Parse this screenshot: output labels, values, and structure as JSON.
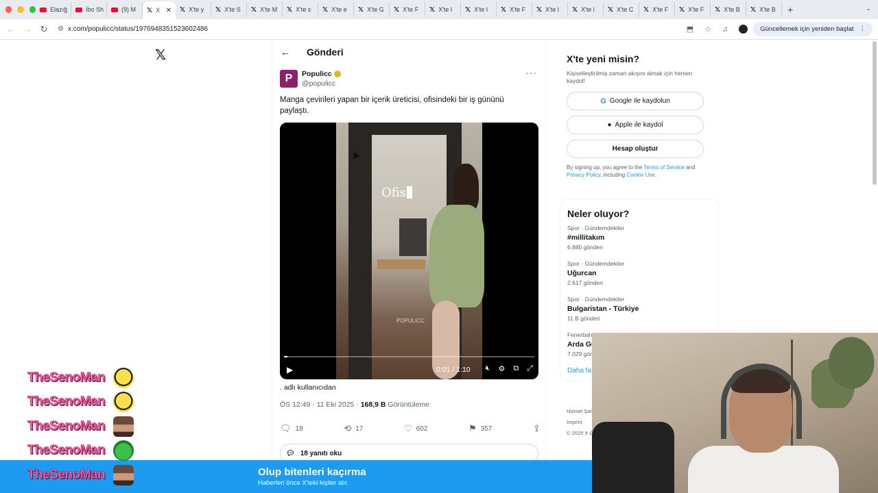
{
  "colors": {
    "x_blue": "#1d9bf0",
    "chat_name": "#ff5aa5",
    "populicc_brand": "#8e1f6d"
  },
  "browser": {
    "traffic_lights": [
      "#ff5f57",
      "#febc2e",
      "#28c840"
    ],
    "tabs": [
      {
        "icon": "youtube-icon",
        "label": "Elazığ"
      },
      {
        "icon": "youtube-icon",
        "label": "İbo Sh"
      },
      {
        "icon": "youtube-icon",
        "label": "(9) M"
      },
      {
        "icon": "x-icon",
        "label": "X",
        "active": true
      },
      {
        "icon": "x-icon",
        "label": "X'te y"
      },
      {
        "icon": "x-icon",
        "label": "X'te S"
      },
      {
        "icon": "x-icon",
        "label": "X'te M"
      },
      {
        "icon": "x-icon",
        "label": "X'te s"
      },
      {
        "icon": "x-icon",
        "label": "X'te e"
      },
      {
        "icon": "x-icon",
        "label": "X'te G"
      },
      {
        "icon": "x-icon",
        "label": "X'te F"
      },
      {
        "icon": "x-icon",
        "label": "X'te I"
      },
      {
        "icon": "x-icon",
        "label": "X'te I"
      },
      {
        "icon": "x-icon",
        "label": "X'te F"
      },
      {
        "icon": "x-icon",
        "label": "X'te l"
      },
      {
        "icon": "x-icon",
        "label": "X'te l"
      },
      {
        "icon": "x-icon",
        "label": "X'te C"
      },
      {
        "icon": "x-icon",
        "label": "X'te F"
      },
      {
        "icon": "x-icon",
        "label": "X'te F"
      },
      {
        "icon": "x-icon",
        "label": "X'te B"
      },
      {
        "icon": "x-icon",
        "label": "X'te B"
      }
    ],
    "url": "x.com/populicc/status/1976948351523602486",
    "update_button": "Güncellemek için yeniden başlat"
  },
  "post": {
    "header_title": "Gönderi",
    "author_initial": "P",
    "author_name": "Populicc",
    "author_handle": "@populicc",
    "text": "Manga çevirileri yapan bir içerik üreticisi, ofisindeki bir iş gününü paylaştı.",
    "video": {
      "caption": "Ofis",
      "watermark": "POPULICC",
      "time": "0:01 / 1:10",
      "progress": 0.014
    },
    "from_user": ". adlı kullanıcıdan",
    "timestamp": "ÖS 12:49 · 11 Eki 2025 · ",
    "views_count": "168,9 B",
    "views_label": " Görüntüleme",
    "actions": {
      "replies": "18",
      "reposts": "17",
      "likes": "602",
      "bookmarks": "357"
    },
    "read_replies": "18 yanıtı oku"
  },
  "signup": {
    "title": "X'te yeni misin?",
    "subtitle": "Kişiselleştirilmiş zaman akışını almak için hemen kaydol!",
    "google_button": "Google ile kaydolun",
    "apple_button": "Apple ile kaydol",
    "create_button": "Hesap oluştur",
    "legal_prefix": "By signing up, you agree to the ",
    "terms": "Terms of Service",
    "legal_and": " and ",
    "privacy": "Privacy Policy",
    "legal_including": ", including ",
    "cookie": "Cookie Use",
    "legal_end": "."
  },
  "trends": {
    "title": "Neler oluyor?",
    "items": [
      {
        "category": "Spor · Gündemdekiler",
        "name": "#millitakım",
        "count": "6.880 gönderi"
      },
      {
        "category": "Spor · Gündemdekiler",
        "name": "Uğurcan",
        "count": "2.617 gönderi"
      },
      {
        "category": "Spor · Gündemdekiler",
        "name": "Bulgaristan - Türkiye",
        "count": "11 B gönderi"
      },
      {
        "category": "Fenerbah",
        "name": "Arda Gü",
        "count": "7.029 gön"
      }
    ],
    "show_more": "Daha fa"
  },
  "footer": {
    "line1": "Hizmet Şar",
    "line2": "Imprint",
    "line3": "© 2025 X C"
  },
  "banner": {
    "title": "Olup bitenleri kaçırma",
    "subtitle": "Haberleri önce X'teki kişiler alır."
  },
  "stream_chat": {
    "lines": [
      {
        "name": "TheSenoMan",
        "emote": "bee-emote"
      },
      {
        "name": "TheSenoMan",
        "emote": "bee-emote"
      },
      {
        "name": "TheSenoMan",
        "emote": "man-emote"
      },
      {
        "name": "TheSenoMan",
        "emote": "frog-emote"
      },
      {
        "name": "TheSenoMan",
        "emote": "man-emote"
      }
    ]
  }
}
